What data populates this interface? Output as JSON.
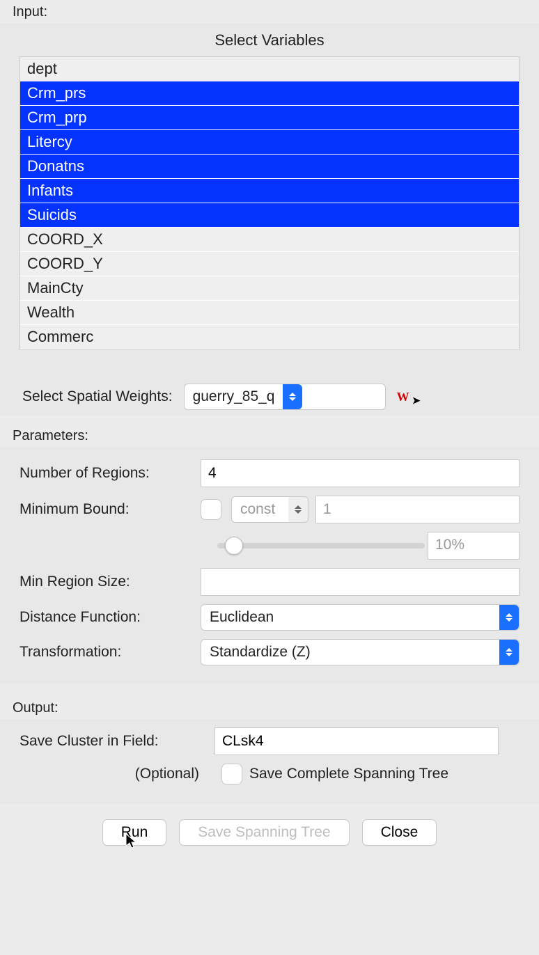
{
  "input": {
    "label": "Input:",
    "title": "Select Variables",
    "variables": [
      {
        "name": "dept",
        "selected": false
      },
      {
        "name": "Crm_prs",
        "selected": true
      },
      {
        "name": "Crm_prp",
        "selected": true
      },
      {
        "name": "Litercy",
        "selected": true
      },
      {
        "name": "Donatns",
        "selected": true
      },
      {
        "name": "Infants",
        "selected": true
      },
      {
        "name": "Suicids",
        "selected": true
      },
      {
        "name": "COORD_X",
        "selected": false
      },
      {
        "name": "COORD_Y",
        "selected": false
      },
      {
        "name": "MainCty",
        "selected": false
      },
      {
        "name": "Wealth",
        "selected": false
      },
      {
        "name": "Commerc",
        "selected": false
      }
    ],
    "weights_label": "Select Spatial Weights:",
    "weights_value": "guerry_85_q"
  },
  "parameters": {
    "label": "Parameters:",
    "num_regions_label": "Number of Regions:",
    "num_regions_value": "4",
    "min_bound_label": "Minimum Bound:",
    "min_bound_checked": false,
    "min_bound_field_value": "const",
    "min_bound_threshold": "1",
    "min_bound_percent": "10%",
    "min_region_size_label": "Min Region Size:",
    "min_region_size_value": "",
    "distance_function_label": "Distance Function:",
    "distance_function_value": "Euclidean",
    "transformation_label": "Transformation:",
    "transformation_value": "Standardize (Z)"
  },
  "output": {
    "label": "Output:",
    "save_cluster_label": "Save Cluster in Field:",
    "save_cluster_value": "CLsk4",
    "optional_label": "(Optional)",
    "save_spanning_tree_label": "Save Complete Spanning Tree",
    "save_spanning_tree_checked": false
  },
  "buttons": {
    "run": "Run",
    "save_spanning_tree": "Save Spanning Tree",
    "close": "Close"
  },
  "icons": {
    "weights_tool": "W"
  }
}
